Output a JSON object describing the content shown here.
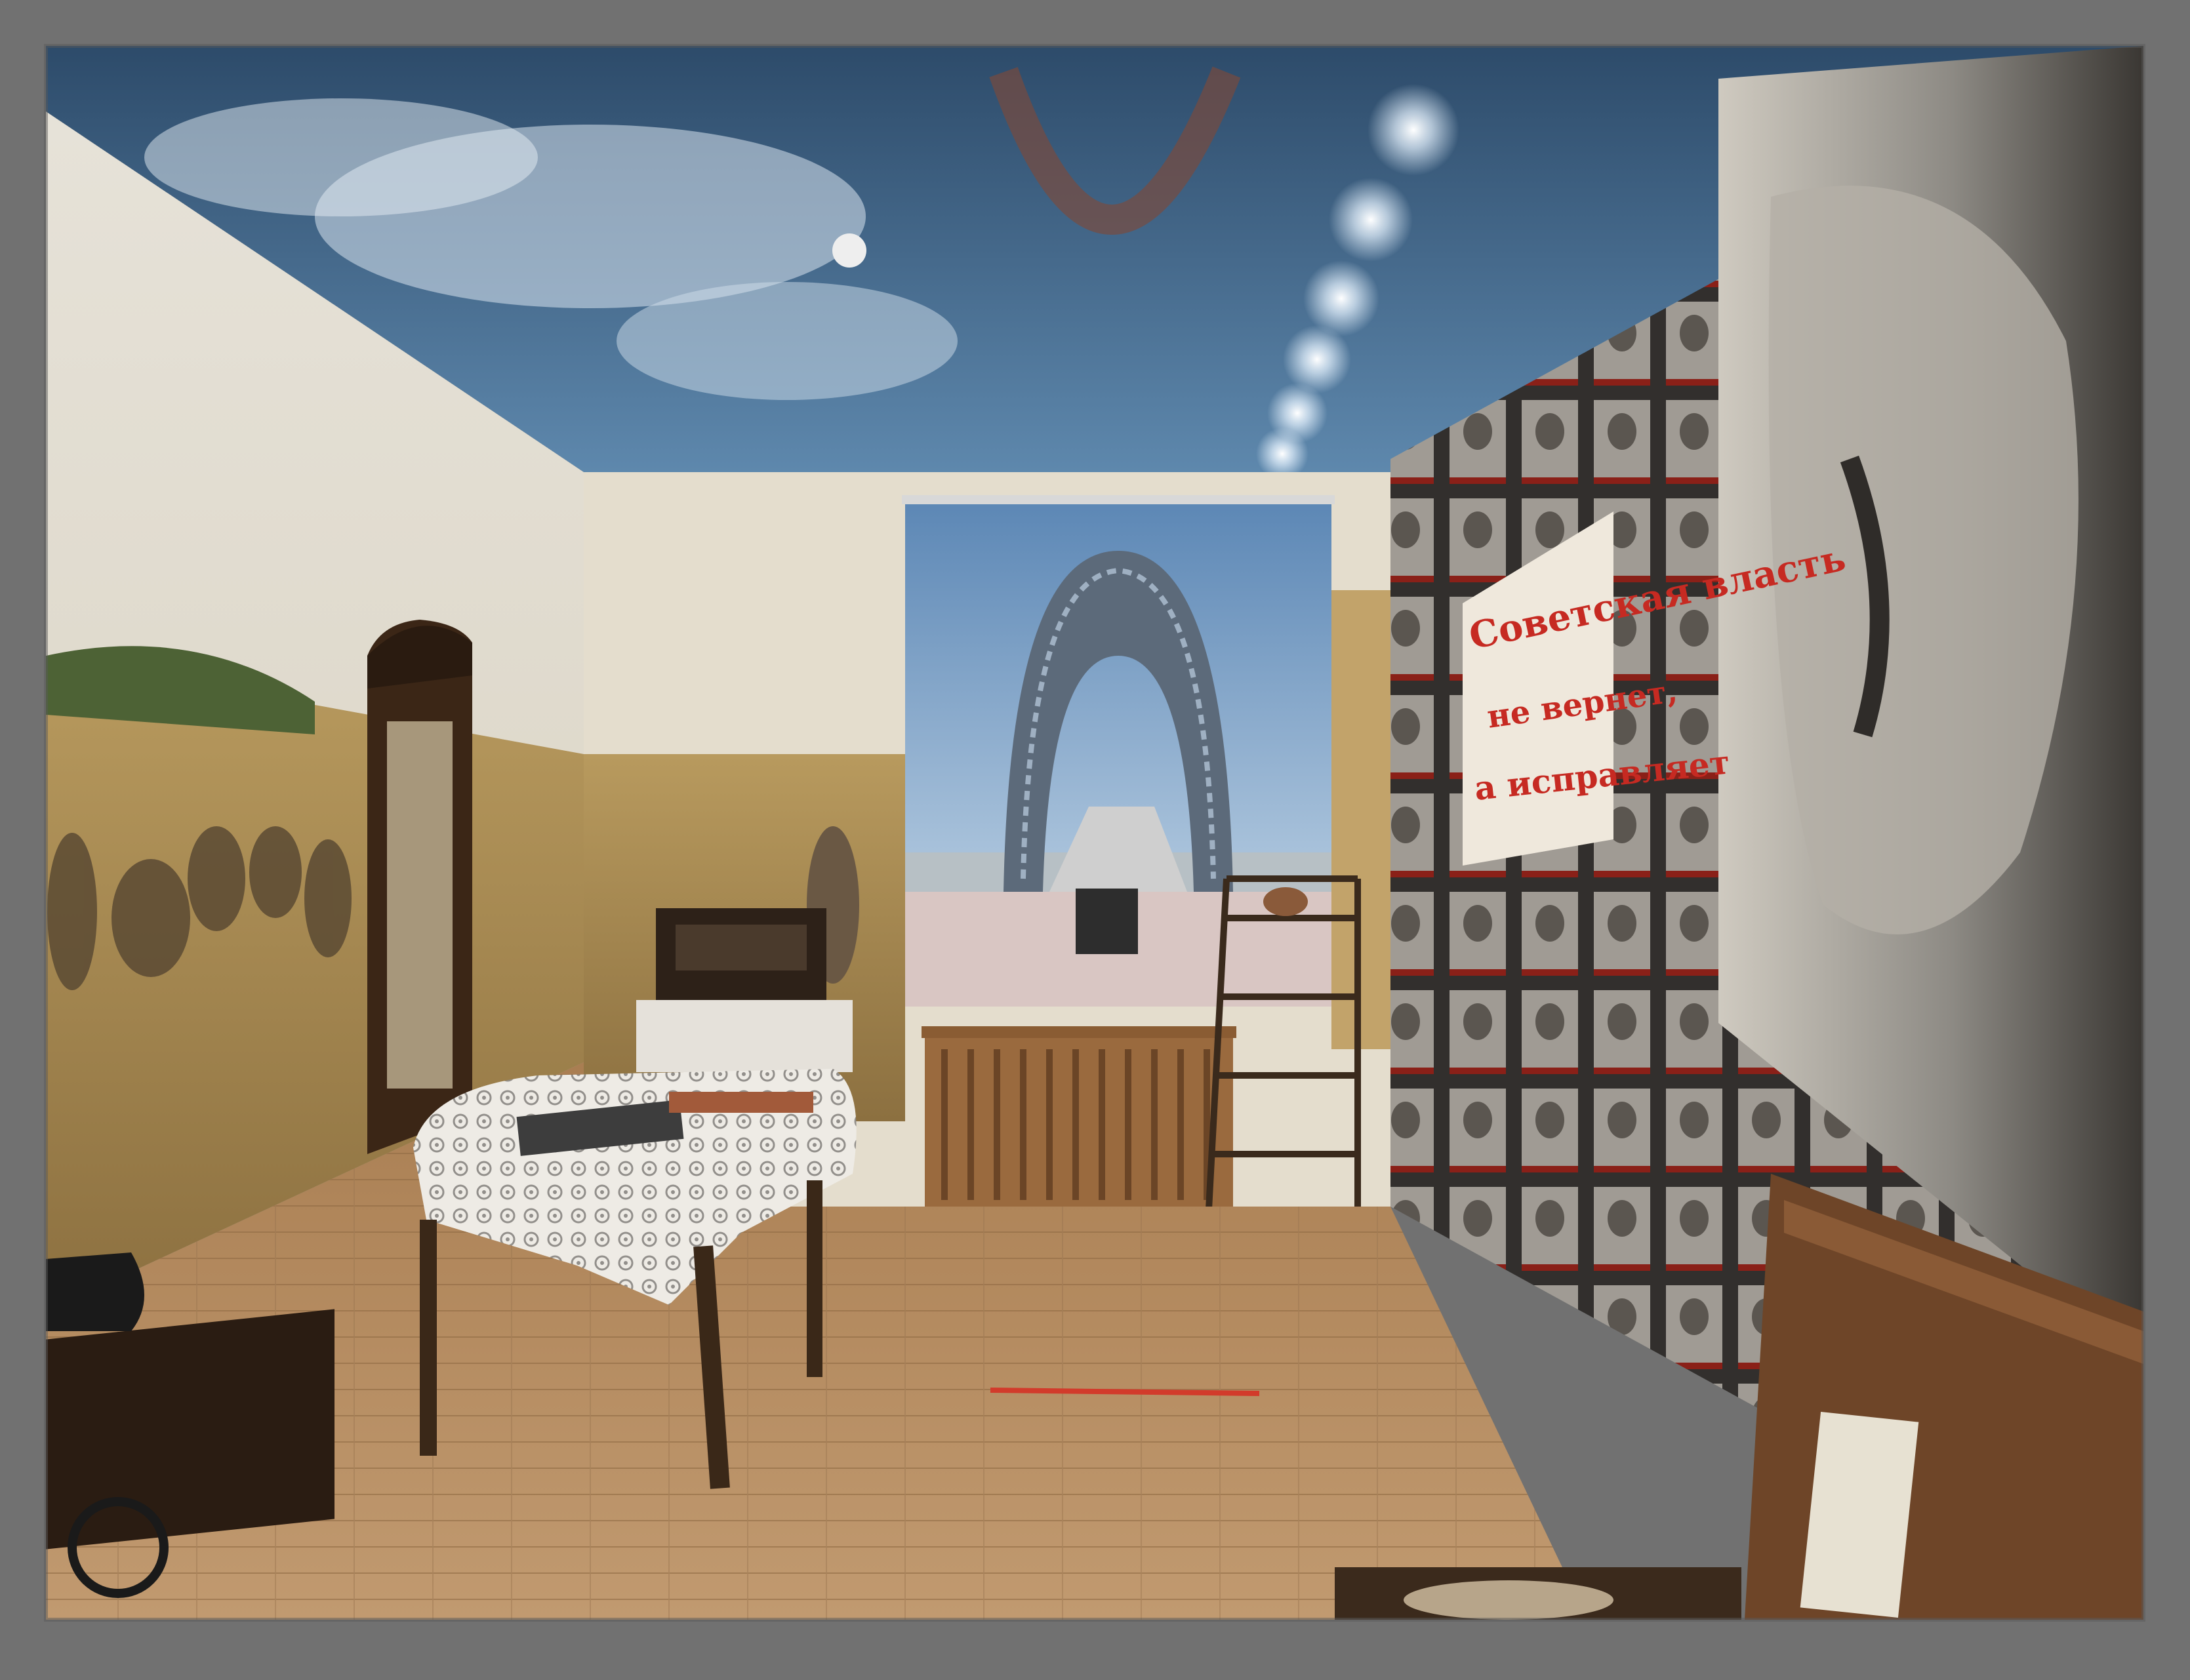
{
  "image": {
    "subject": "museum-room-exhibit",
    "banner": {
      "line1": "Советская власть",
      "line2": "не вернет,",
      "line3": "а исправляет"
    },
    "colors": {
      "frame": "#7d7d7d",
      "ceiling_sky": "#3f6f99",
      "wall": "#e9e4d6",
      "floor": "#b48a5e",
      "banner_text": "#c62a22",
      "portrait_border": "#a3261d"
    }
  }
}
